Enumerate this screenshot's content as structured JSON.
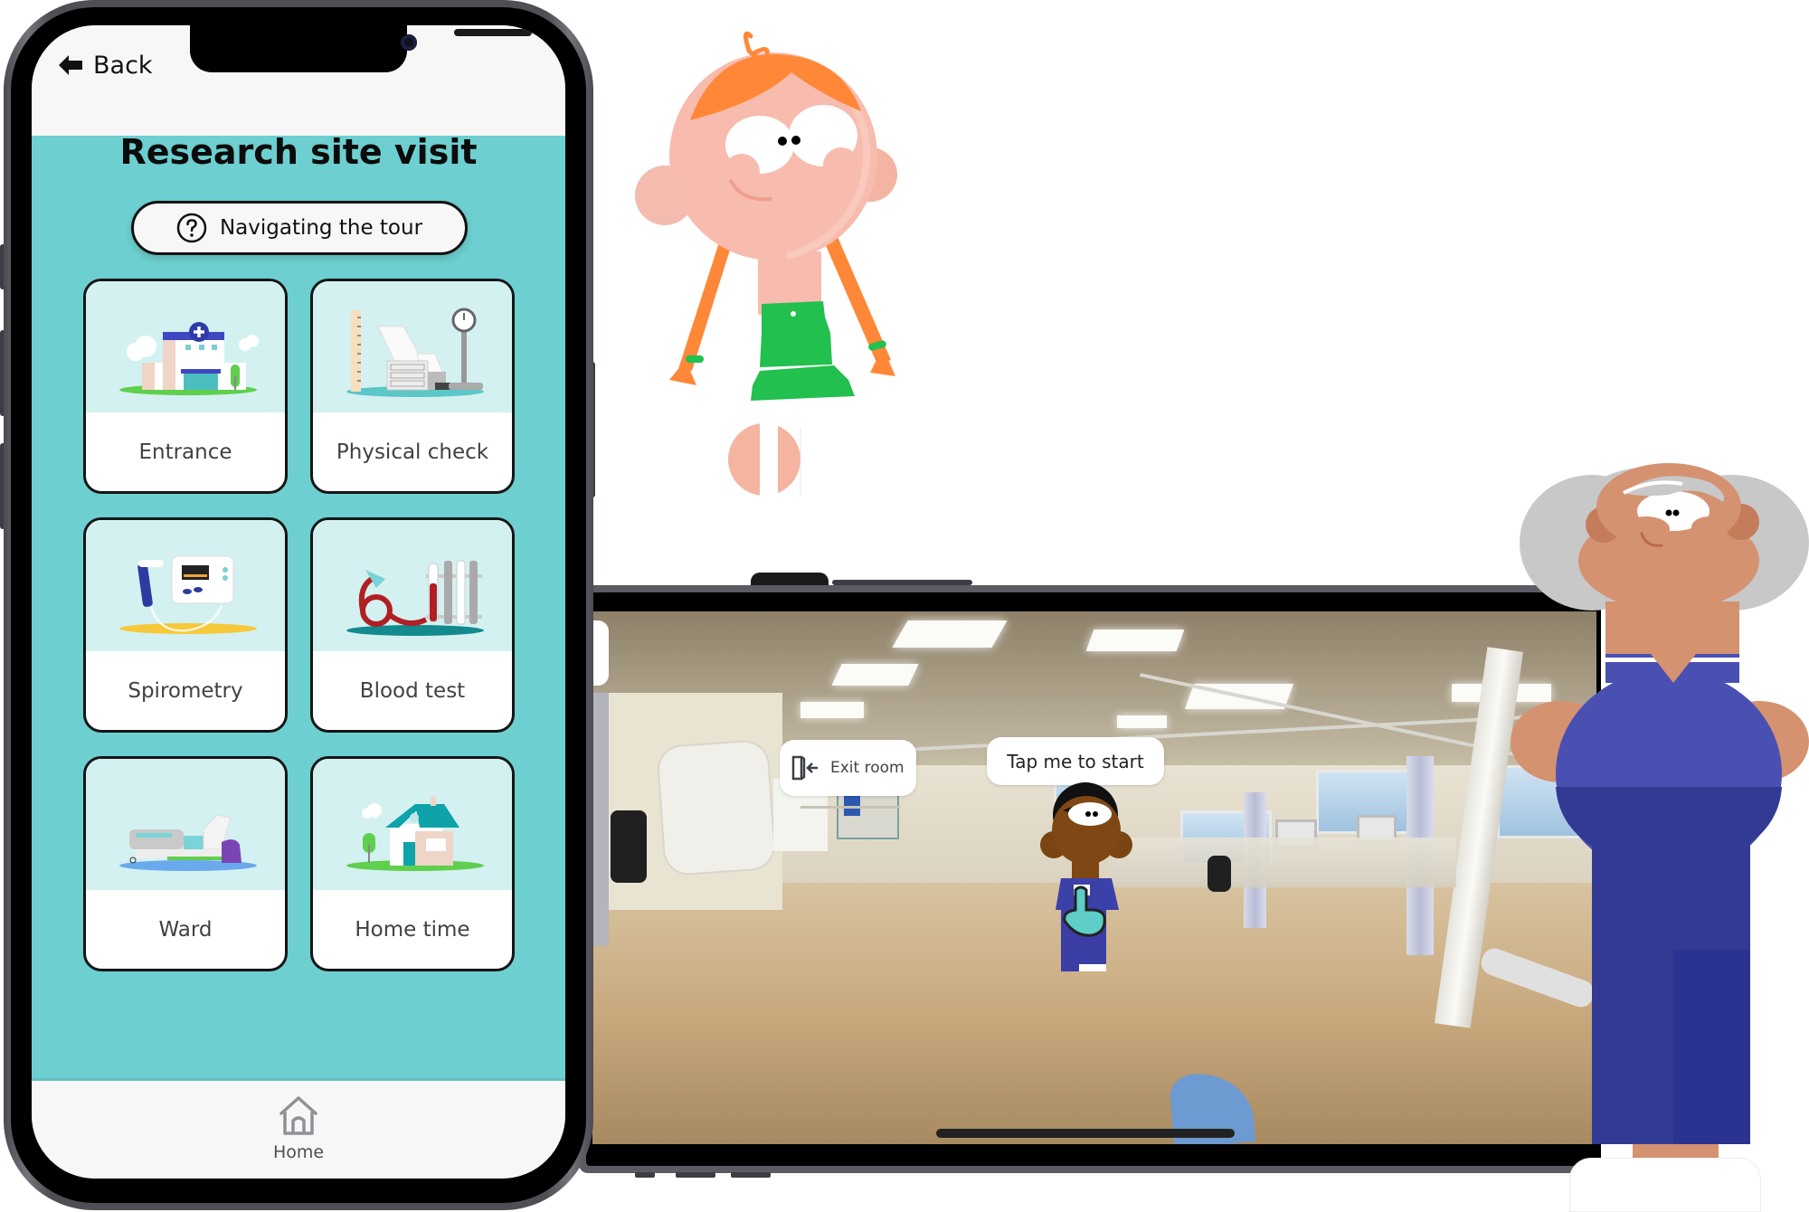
{
  "portrait_app": {
    "header": {
      "back_label": "Back",
      "back_icon": "arrow-left-icon"
    },
    "title": "Research site visit",
    "help_button": {
      "label": "Navigating the tour",
      "icon": "question-circle-icon"
    },
    "tiles": [
      {
        "label": "Entrance",
        "icon": "hospital-building-illustration"
      },
      {
        "label": "Physical check",
        "icon": "height-scale-bed-illustration"
      },
      {
        "label": "Spirometry",
        "icon": "spirometer-illustration"
      },
      {
        "label": "Blood test",
        "icon": "blood-tubes-illustration"
      },
      {
        "label": "Ward",
        "icon": "hospital-bed-illustration"
      },
      {
        "label": "Home time",
        "icon": "house-illustration"
      }
    ],
    "bottom_nav": {
      "home_label": "Home",
      "home_icon": "home-icon"
    },
    "colors": {
      "background": "#6dcfcf",
      "tile_art_bg": "#d3f1f0",
      "header_bg": "#f7f7f7"
    }
  },
  "landscape_app": {
    "exit_button": {
      "label": "Exit room",
      "icon": "exit-door-icon"
    },
    "speech_bubble": {
      "label": "Tap me to start"
    },
    "guide_character": "nurse-guide-with-tap-hand",
    "scene": "hospital-ward-360-photo"
  },
  "decorations": {
    "characters": [
      "girl-with-orange-pigtails",
      "grey-haired-nurse"
    ]
  }
}
